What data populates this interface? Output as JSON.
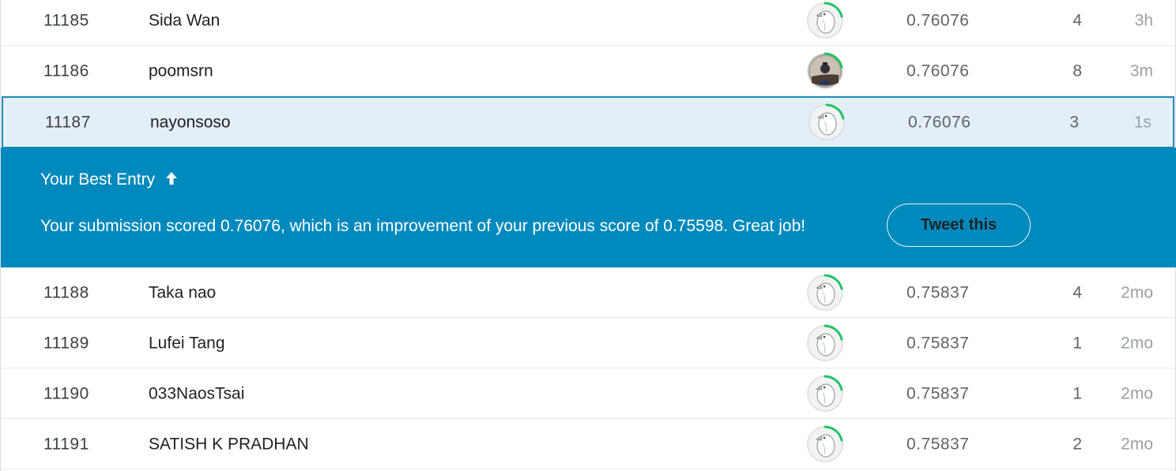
{
  "rows_top": [
    {
      "rank": "11185",
      "name": "Sida Wan",
      "avatar": "goose-avatar-icon",
      "score": "0.76076",
      "entries": "4",
      "last": "3h"
    },
    {
      "rank": "11186",
      "name": "poomsrn",
      "avatar": "user-photo-avatar",
      "score": "0.76076",
      "entries": "8",
      "last": "3m"
    }
  ],
  "highlight_row": {
    "rank": "11187",
    "name": "nayonsoso",
    "avatar": "goose-avatar-icon",
    "score": "0.76076",
    "entries": "3",
    "last": "1s"
  },
  "banner": {
    "title": "Your Best Entry",
    "title_icon": "arrow-up-icon",
    "message": "Your submission scored 0.76076, which is an improvement of your previous score of 0.75598. Great job!",
    "tweet_label": "Tweet this",
    "background_color": "#0089bd"
  },
  "rows_bottom": [
    {
      "rank": "11188",
      "name": "Taka nao",
      "avatar": "goose-avatar-icon",
      "score": "0.75837",
      "entries": "4",
      "last": "2mo"
    },
    {
      "rank": "11189",
      "name": "Lufei Tang",
      "avatar": "goose-avatar-icon",
      "score": "0.75837",
      "entries": "1",
      "last": "2mo"
    },
    {
      "rank": "11190",
      "name": "033NaosTsai",
      "avatar": "goose-avatar-icon",
      "score": "0.75837",
      "entries": "1",
      "last": "2mo"
    },
    {
      "rank": "11191",
      "name": "SATISH K PRADHAN",
      "avatar": "goose-avatar-icon",
      "score": "0.75837",
      "entries": "2",
      "last": "2mo"
    }
  ],
  "colors": {
    "progress_ring": "#20c463",
    "highlight_border": "#1e8cb5",
    "highlight_bg": "#e3eff6"
  }
}
